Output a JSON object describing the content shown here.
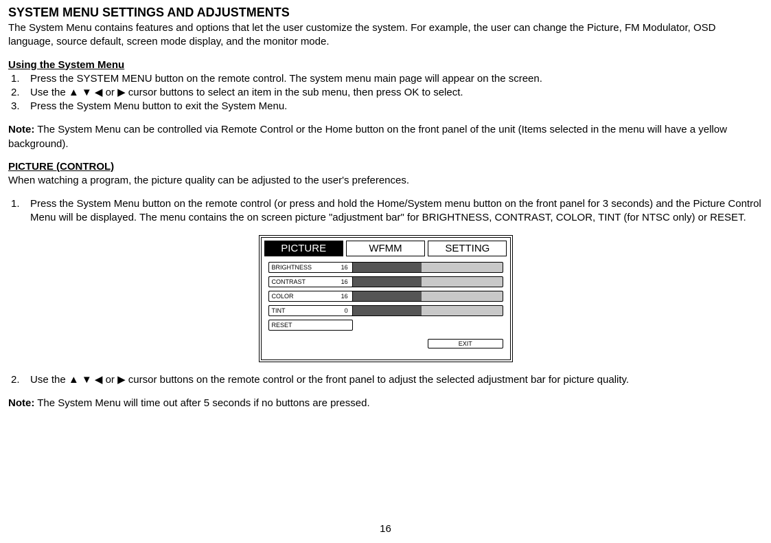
{
  "title": "SYSTEM MENU SETTINGS AND ADJUSTMENTS",
  "intro": "The System Menu contains features and options that let the user customize the system. For example, the user can change the Picture, FM Modulator, OSD language, source default, screen mode display, and the monitor mode.",
  "section1_heading": "Using the System Menu",
  "steps1": [
    "Press the SYSTEM MENU button on the remote control. The system menu main page will appear on the screen.",
    " Use the ▲ ▼ ◀ or ▶ cursor buttons to select an item in the sub menu, then press OK to select.",
    "Press the System Menu button to exit the System Menu."
  ],
  "note1_label": "Note:",
  "note1_text": " The System Menu can be controlled via Remote Control or the Home button on the front panel of the unit (Items selected in the menu will have a yellow background).",
  "section2_heading": "PICTURE (CONTROL)",
  "section2_intro": "When watching a program, the picture quality can be adjusted to the user's preferences.",
  "steps2_item1": "Press the System Menu button on the remote control (or press and hold the Home/System menu button on the front panel for 3 seconds) and the Picture Control Menu will be displayed. The menu contains the on screen picture  \"adjustment bar\" for BRIGHTNESS, CONTRAST, COLOR, TINT (for NTSC only) or RESET.",
  "steps2_item2": "Use the ▲ ▼ ◀ or ▶ cursor buttons on the remote control or the front panel to adjust the selected adjustment bar for picture quality.",
  "note2_label": "Note:",
  "note2_text": " The System Menu will time out after 5 seconds if no buttons are pressed.",
  "page_number": "16",
  "menu": {
    "tabs": [
      "PICTURE",
      "WFMM",
      "SETTING"
    ],
    "active_tab": "PICTURE",
    "sliders": [
      {
        "name": "BRIGHTNESS",
        "value": "16"
      },
      {
        "name": "CONTRAST",
        "value": "16"
      },
      {
        "name": "COLOR",
        "value": "16"
      },
      {
        "name": "TINT",
        "value": "0"
      }
    ],
    "reset": "RESET",
    "exit": "EXIT"
  }
}
